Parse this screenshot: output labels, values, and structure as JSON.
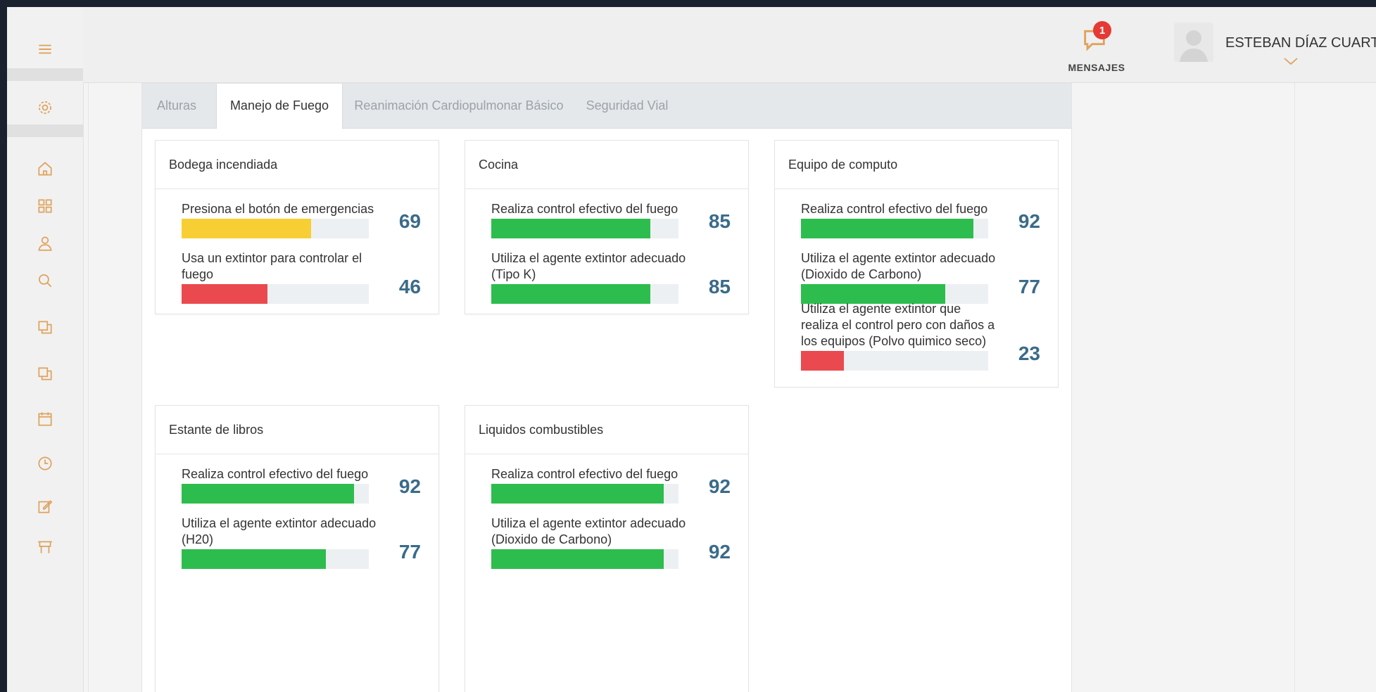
{
  "colors": {
    "green": "#2dbd4e",
    "yellow": "#f7cf35",
    "red": "#ea4a4f",
    "value_blue": "#3a6b8a",
    "badge_red": "#e53935"
  },
  "sidebar": {
    "items": [
      {
        "icon": "menu-icon"
      },
      {
        "icon": "gear-icon"
      },
      {
        "icon": "home-icon"
      },
      {
        "icon": "grid-icon"
      },
      {
        "icon": "user-icon"
      },
      {
        "icon": "search-icon"
      },
      {
        "icon": "stack-icon"
      },
      {
        "icon": "stack-icon"
      },
      {
        "icon": "calendar-icon"
      },
      {
        "icon": "clock-icon"
      },
      {
        "icon": "edit-icon"
      },
      {
        "icon": "cart-icon"
      }
    ]
  },
  "header": {
    "messages": {
      "label": "MENSAJES",
      "badge": "1",
      "icon": "chat-icon"
    },
    "user": {
      "name": "ESTEBAN DÍAZ CUARTAS",
      "icon": "chevron-down-icon"
    }
  },
  "tabs": [
    {
      "label": "Alturas",
      "active": false
    },
    {
      "label": "Manejo de Fuego",
      "active": true
    },
    {
      "label": "Reanimación Cardiopulmonar Básico",
      "active": false
    },
    {
      "label": "Seguridad Vial",
      "active": false
    }
  ],
  "cards": [
    {
      "title": "Bodega incendiada",
      "items": [
        {
          "label": "Presiona el botón de emergencias",
          "value": "69",
          "fill": 0.69,
          "color": "#f7cf35"
        },
        {
          "label": "Usa un extintor para controlar el fuego",
          "value": "46",
          "fill": 0.46,
          "color": "#ea4a4f"
        }
      ]
    },
    {
      "title": "Cocina",
      "items": [
        {
          "label": "Realiza control efectivo del fuego",
          "value": "85",
          "fill": 0.85,
          "color": "#2dbd4e"
        },
        {
          "label": "Utiliza el agente extintor adecuado (Tipo K)",
          "value": "85",
          "fill": 0.85,
          "color": "#2dbd4e"
        }
      ]
    },
    {
      "title": "Equipo de computo",
      "items": [
        {
          "label": "Realiza control efectivo del fuego",
          "value": "92",
          "fill": 0.92,
          "color": "#2dbd4e"
        },
        {
          "label": "Utiliza el agente extintor adecuado (Dioxido de Carbono)",
          "value": "77",
          "fill": 0.77,
          "color": "#2dbd4e"
        },
        {
          "label": "Utiliza el agente extintor que realiza el control pero con daños a los equipos (Polvo quimico seco)",
          "value": "23",
          "fill": 0.23,
          "color": "#ea4a4f"
        }
      ]
    },
    {
      "title": "Estante de libros",
      "items": [
        {
          "label": "Realiza control efectivo del fuego",
          "value": "92",
          "fill": 0.92,
          "color": "#2dbd4e"
        },
        {
          "label": "Utiliza el agente extintor adecuado (H20)",
          "value": "77",
          "fill": 0.77,
          "color": "#2dbd4e"
        }
      ]
    },
    {
      "title": "Liquidos combustibles",
      "items": [
        {
          "label": "Realiza control efectivo del fuego",
          "value": "92",
          "fill": 0.92,
          "color": "#2dbd4e"
        },
        {
          "label": "Utiliza el agente extintor adecuado (Dioxido de Carbono)",
          "value": "92",
          "fill": 0.92,
          "color": "#2dbd4e"
        }
      ]
    }
  ]
}
